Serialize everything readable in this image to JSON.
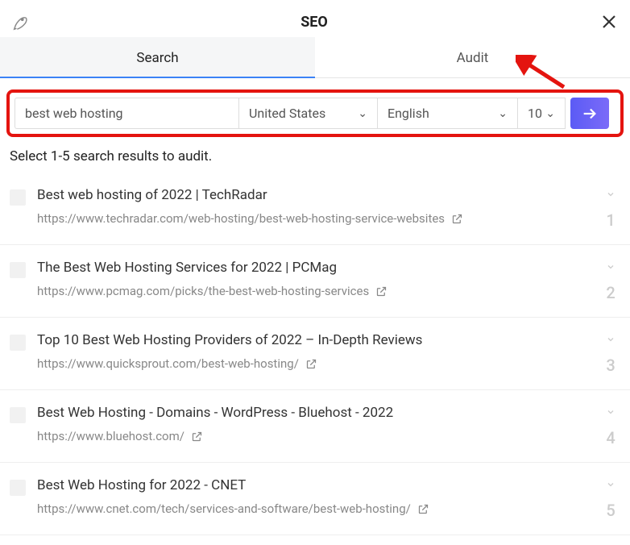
{
  "header": {
    "title": "SEO"
  },
  "tabs": {
    "search": "Search",
    "audit": "Audit"
  },
  "search": {
    "query": "best web hosting",
    "country": "United States",
    "language": "English",
    "count": "10"
  },
  "instruction": "Select 1-5 search results to audit.",
  "results": [
    {
      "title": "Best web hosting of 2022 | TechRadar",
      "url": "https://www.techradar.com/web-hosting/best-web-hosting-service-websites",
      "rank": "1"
    },
    {
      "title": "The Best Web Hosting Services for 2022 | PCMag",
      "url": "https://www.pcmag.com/picks/the-best-web-hosting-services",
      "rank": "2"
    },
    {
      "title": "Top 10 Best Web Hosting Providers of 2022 – In-Depth Reviews",
      "url": "https://www.quicksprout.com/best-web-hosting/",
      "rank": "3"
    },
    {
      "title": "Best Web Hosting - Domains - WordPress - Bluehost - 2022",
      "url": "https://www.bluehost.com/",
      "rank": "4"
    },
    {
      "title": "Best Web Hosting for 2022 - CNET",
      "url": "https://www.cnet.com/tech/services-and-software/best-web-hosting/",
      "rank": "5"
    }
  ]
}
